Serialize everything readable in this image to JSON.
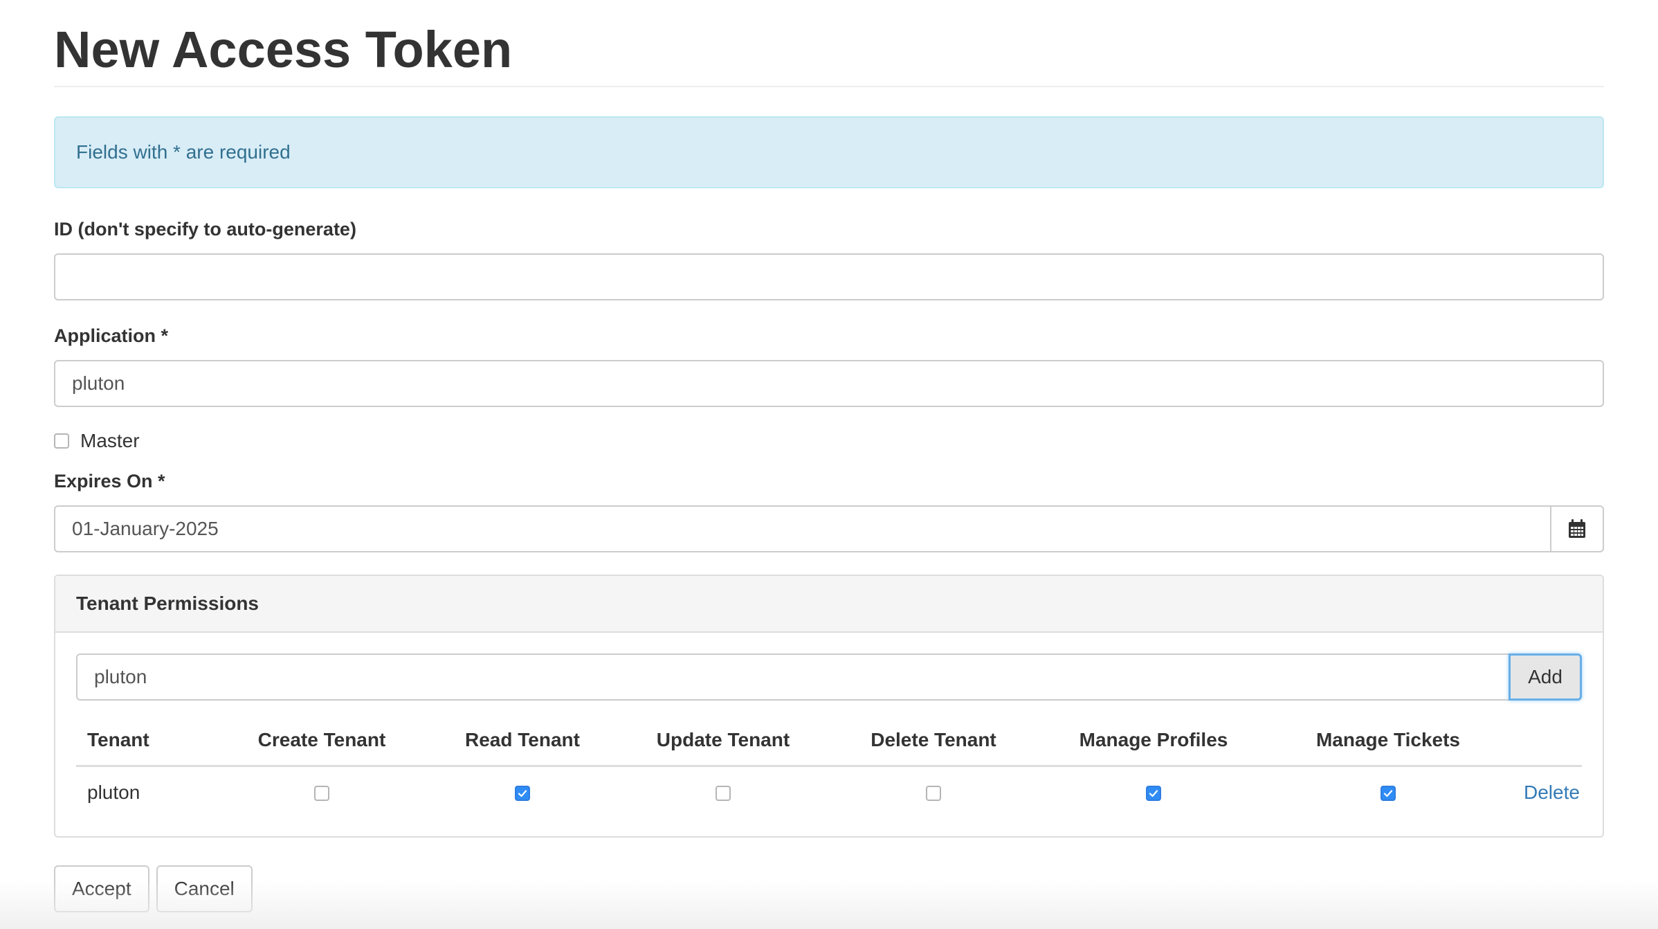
{
  "page": {
    "title": "New Access Token"
  },
  "alert": {
    "text": "Fields with * are required"
  },
  "form": {
    "id_label": "ID (don't specify to auto-generate)",
    "id_value": "",
    "application_label": "Application *",
    "application_value": "pluton",
    "master_label": "Master",
    "master_checked": false,
    "expires_label": "Expires On *",
    "expires_value": "01-January-2025",
    "calendar_icon": "calendar-icon"
  },
  "tenant_permissions": {
    "heading": "Tenant Permissions",
    "tenant_input_value": "pluton",
    "add_label": "Add",
    "columns": [
      "Tenant",
      "Create Tenant",
      "Read Tenant",
      "Update Tenant",
      "Delete Tenant",
      "Manage Profiles",
      "Manage Tickets"
    ],
    "rows": [
      {
        "tenant": "pluton",
        "create": false,
        "read": true,
        "update": false,
        "delete": false,
        "manage_profiles": true,
        "manage_tickets": true,
        "delete_link": "Delete"
      }
    ]
  },
  "actions": {
    "accept_label": "Accept",
    "cancel_label": "Cancel"
  },
  "colors": {
    "checkbox_checked": "#2f8cf5",
    "link": "#337ab7",
    "alert_bg": "#d9edf7",
    "alert_text": "#31708f"
  }
}
